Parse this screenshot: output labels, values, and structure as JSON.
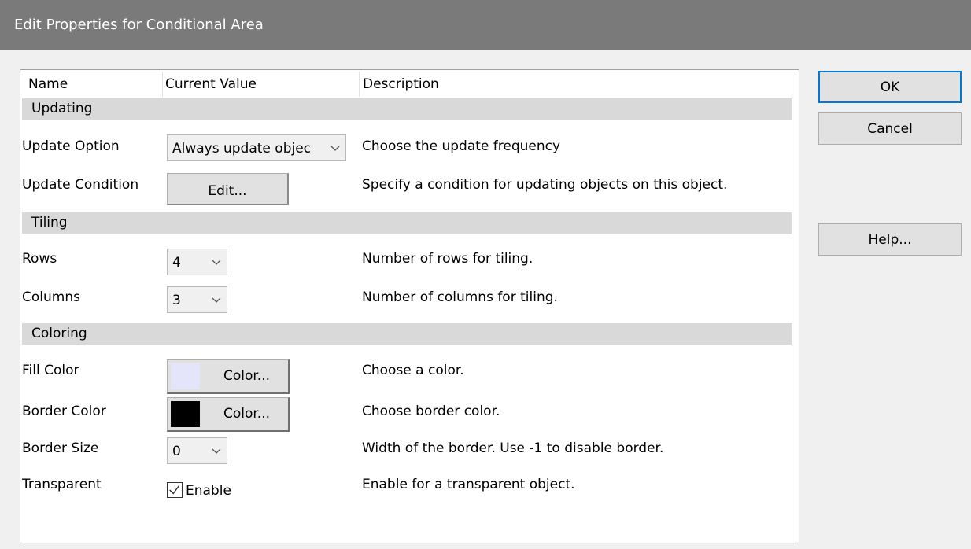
{
  "window": {
    "title": "Edit Properties for Conditional Area"
  },
  "table": {
    "headers": {
      "name": "Name",
      "value": "Current Value",
      "description": "Description"
    },
    "sections": {
      "updating": "Updating",
      "tiling": "Tiling",
      "coloring": "Coloring"
    },
    "rows": {
      "update_option": {
        "name": "Update Option",
        "value": "Always update objec",
        "description": "Choose the update frequency"
      },
      "update_condition": {
        "name": "Update Condition",
        "button": "Edit...",
        "description": "Specify a condition for updating objects on this object."
      },
      "rows": {
        "name": "Rows",
        "value": "4",
        "description": "Number of rows for tiling."
      },
      "columns": {
        "name": "Columns",
        "value": "3",
        "description": "Number of columns for tiling."
      },
      "fill_color": {
        "name": "Fill Color",
        "button": "Color...",
        "swatch": "#e4e4fb",
        "description": "Choose a color."
      },
      "border_color": {
        "name": "Border Color",
        "button": "Color...",
        "swatch": "#000000",
        "description": "Choose border color."
      },
      "border_size": {
        "name": "Border Size",
        "value": "0",
        "description": "Width of the border. Use -1 to disable border."
      },
      "transparent": {
        "name": "Transparent",
        "checkbox_label": "Enable",
        "checked": true,
        "description": "Enable for a transparent object."
      }
    }
  },
  "buttons": {
    "ok": "OK",
    "cancel": "Cancel",
    "help": "Help..."
  },
  "icons": {
    "dropdown": "chevron-down-icon",
    "check": "checkmark-icon"
  }
}
